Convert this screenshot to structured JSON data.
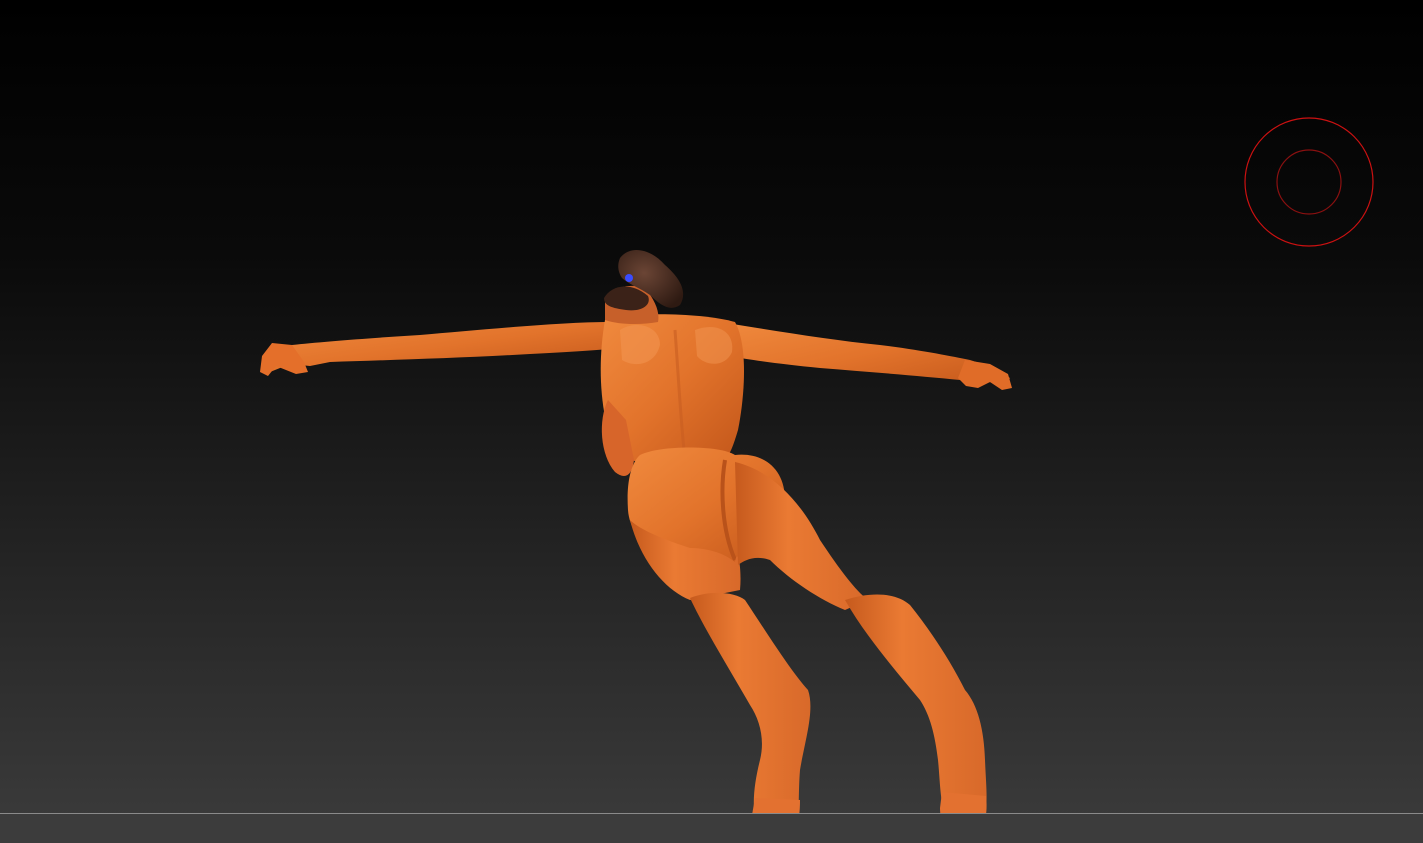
{
  "viewport": {
    "background_top": "#000000",
    "background_bottom": "#3a3a3a",
    "ground_line_color": "#8a8a8a"
  },
  "model": {
    "material_color": "#e9752e",
    "material_shadow": "#b94f16",
    "material_highlight": "#f5944f",
    "hair_color": "#4a2c20"
  },
  "brush_cursor": {
    "outer_color": "#cc1111",
    "inner_color": "#991111"
  }
}
